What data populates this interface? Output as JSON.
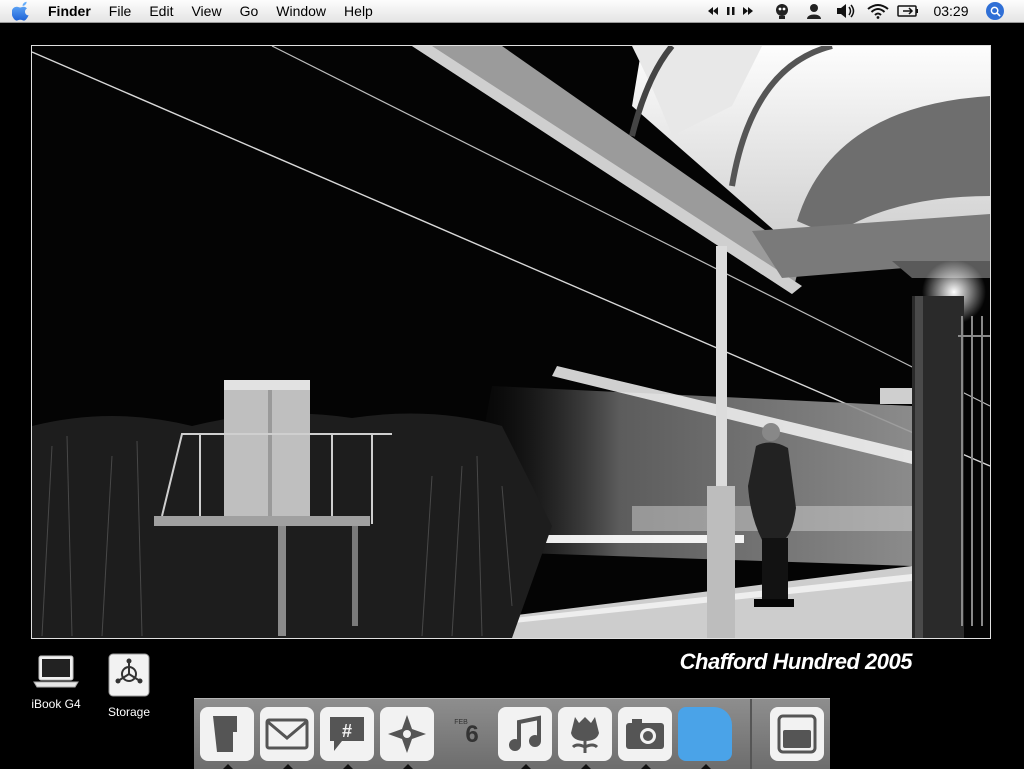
{
  "menubar": {
    "app_name": "Finder",
    "items": [
      "File",
      "Edit",
      "View",
      "Go",
      "Window",
      "Help"
    ],
    "clock": "03:29"
  },
  "desktop": {
    "caption": "Chafford Hundred 2005",
    "icons": [
      {
        "label": "iBook G4",
        "icon": "laptop-icon"
      },
      {
        "label": "Storage",
        "icon": "firewire-drive-icon"
      }
    ]
  },
  "dock": {
    "calendar": {
      "month": "FEB",
      "day": "6"
    },
    "items": [
      "finder-icon",
      "mail-icon",
      "ichat-icon",
      "safari-icon",
      "ical-icon",
      "itunes-icon",
      "flowers-icon",
      "iphoto-icon",
      "blue-folder-icon",
      "trash-icon"
    ]
  },
  "colors": {
    "menubar": "#ececec",
    "dock": "#7d7d7d",
    "accent_blue": "#4aa3e8"
  }
}
